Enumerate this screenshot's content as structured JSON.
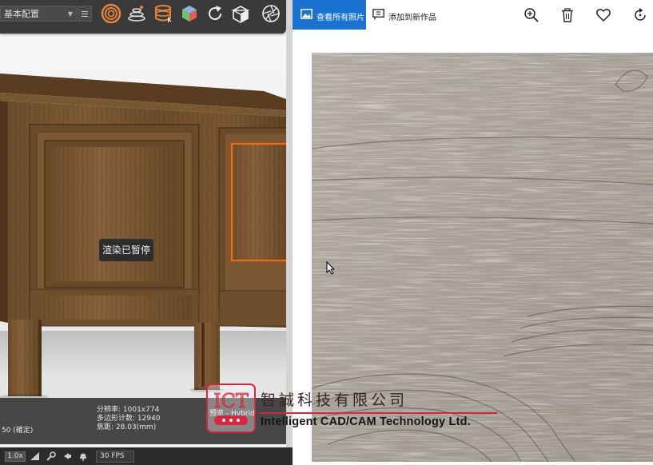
{
  "keyshot": {
    "preset": "基本配置",
    "render_status": "渲染已暂停",
    "stats": {
      "partial_line": "50 (確定)",
      "resolution": "分辨率: 1001x774",
      "polygons": "多边形计数: 12940",
      "focal": "焦距: 28.03(mm)"
    },
    "render_mode": "预览 - Hybrid",
    "zoom": "1.0x",
    "fps": "30 FPS",
    "toolbar_icons": [
      "material-ball-icon",
      "lights-icon",
      "environment-icon",
      "model-cube-icon",
      "refresh-icon",
      "camera-cube-icon",
      "aperture-icon"
    ]
  },
  "photos": {
    "view_all_label": "查看所有照片",
    "add_creation_label": "添加到新作品",
    "toolbar_icons": [
      "zoom-icon",
      "delete-icon",
      "favorite-icon",
      "rotate-icon"
    ]
  },
  "watermark": {
    "logo_text": "ICT",
    "company_cn": "智誠科技有限公司",
    "company_en": "Intelligent CAD/CAM Technology Ltd."
  },
  "colors": {
    "accent_blue": "#1a73d2",
    "selection_orange": "#ff6a00",
    "logo_red": "#d7263d",
    "keyshot_orange": "#e8843a"
  }
}
